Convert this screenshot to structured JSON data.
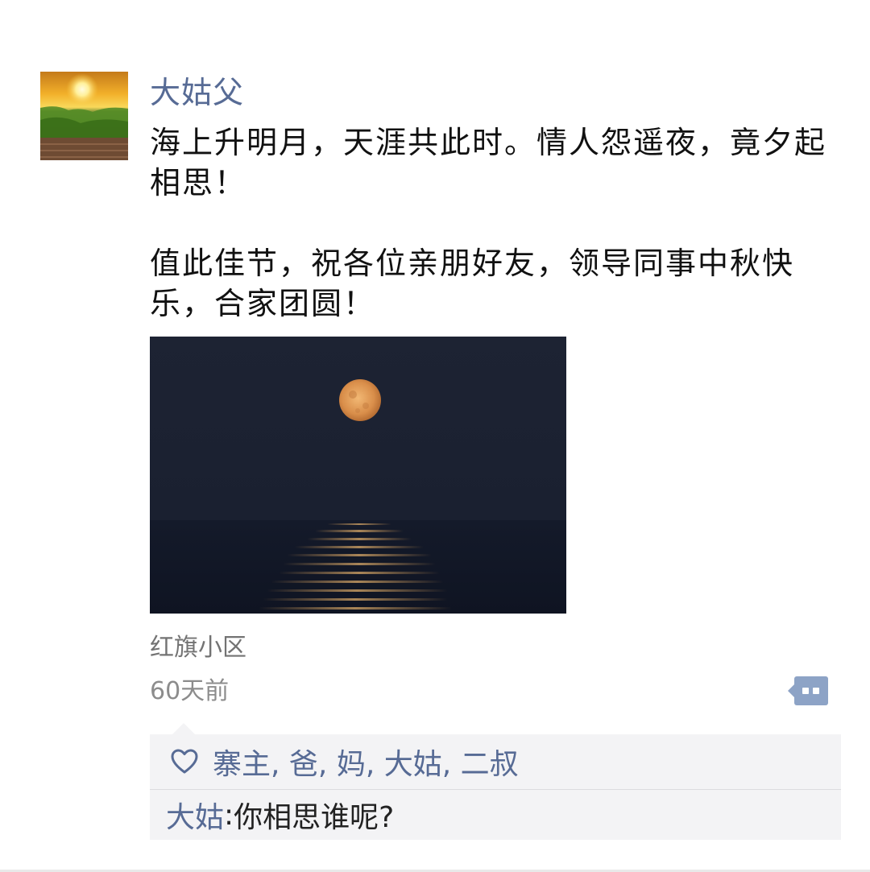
{
  "post": {
    "author": "大姑父",
    "text_line_1": "海上升明月，天涯共此时。情人怨遥夜，竟夕起相思！",
    "text_line_2": "值此佳节，祝各位亲朋好友，领导同事中秋快乐，合家团圆！",
    "location": "红旗小区",
    "time": "60天前"
  },
  "interaction": {
    "likes": [
      "寨主",
      "爸",
      "妈",
      "大姑",
      "二叔"
    ],
    "like_separator": ", ",
    "comments": [
      {
        "author": "大姑",
        "colon": ": ",
        "text": "你相思谁呢?"
      }
    ]
  },
  "icons": {
    "avatar": "sunrise-landscape-avatar",
    "photo": "full-moon-over-sea-photo",
    "more": "more-actions-icon",
    "like": "heart-icon"
  },
  "colors": {
    "link": "#576b95",
    "text": "#111111",
    "meta": "#737373",
    "panel": "#f3f3f5"
  }
}
